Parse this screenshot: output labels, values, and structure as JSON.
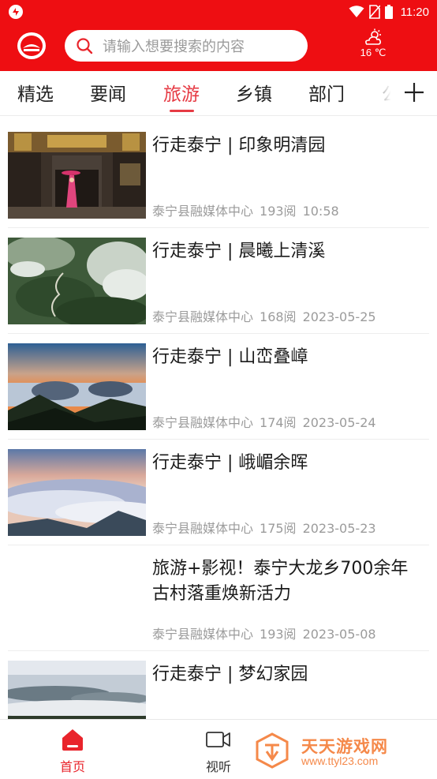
{
  "status_bar": {
    "time": "11:20"
  },
  "header": {
    "search_placeholder": "请输入想要搜索的内容",
    "weather_temp": "16 ℃"
  },
  "tabs": [
    {
      "label": "精选"
    },
    {
      "label": "要闻"
    },
    {
      "label": "旅游",
      "active": true
    },
    {
      "label": "乡镇"
    },
    {
      "label": "部门"
    },
    {
      "label": "公"
    }
  ],
  "feed": [
    {
      "title": "行走泰宁 | 印象明清园",
      "source": "泰宁县融媒体中心",
      "reads": "193阅",
      "time": "10:58",
      "image": "ancient-courtyard-photo"
    },
    {
      "title": "行走泰宁 | 晨曦上清溪",
      "source": "泰宁县融媒体中心",
      "reads": "168阅",
      "time": "2023-05-25",
      "image": "mountain-mist-photo"
    },
    {
      "title": "行走泰宁 | 山峦叠嶂",
      "source": "泰宁县融媒体中心",
      "reads": "174阅",
      "time": "2023-05-24",
      "image": "sunset-mountains-photo"
    },
    {
      "title": "行走泰宁 | 峨嵋余晖",
      "source": "泰宁县融媒体中心",
      "reads": "175阅",
      "time": "2023-05-23",
      "image": "sea-of-clouds-photo"
    },
    {
      "title": "旅游+影视！泰宁大龙乡700余年古村落重焕新活力",
      "source": "泰宁县融媒体中心",
      "reads": "193阅",
      "time": "2023-05-08",
      "image": ""
    },
    {
      "title": "行走泰宁 | 梦幻家园",
      "source": "",
      "reads": "",
      "time": "",
      "image": "misty-village-photo"
    }
  ],
  "bottom_nav": [
    {
      "label": "首页",
      "active": true
    },
    {
      "label": "视听"
    }
  ],
  "watermark": {
    "title": "天天游戏网",
    "url": "www.ttyl23.com"
  },
  "colors": {
    "brand_red": "#ee0e12",
    "tab_active": "#e63b44",
    "meta_gray": "#9b9b9b",
    "watermark_orange": "#f5894a"
  }
}
